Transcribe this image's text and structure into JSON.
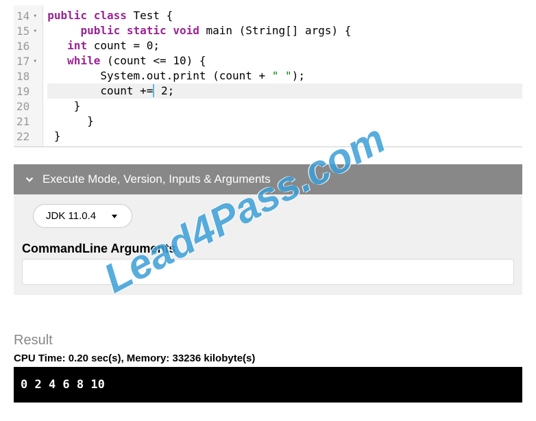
{
  "code": {
    "lines": [
      {
        "num": "14",
        "fold": true
      },
      {
        "num": "15",
        "fold": true
      },
      {
        "num": "16",
        "fold": false
      },
      {
        "num": "17",
        "fold": true
      },
      {
        "num": "18",
        "fold": false
      },
      {
        "num": "19",
        "fold": false,
        "highlight": true
      },
      {
        "num": "20",
        "fold": false
      },
      {
        "num": "21",
        "fold": false
      },
      {
        "num": "22",
        "fold": false
      }
    ],
    "tokens": {
      "l14": {
        "kw_public": "public",
        "kw_class": "class",
        "name": "Test"
      },
      "l15": {
        "kw_public": "public",
        "kw_static": "static",
        "kw_void": "void",
        "fn": "main",
        "params": "(String[] args) {"
      },
      "l16": {
        "type": "int",
        "decl": " count = ",
        "val": "0",
        "semi": ";"
      },
      "l17": {
        "kw_while": "while",
        "cond_open": " (count ",
        "op": "<=",
        "sp": " ",
        "val": "10",
        "cond_close": ") {"
      },
      "l18": {
        "call": "System.out.print (count ",
        "plus": "+",
        "str": " \" \"",
        "close": ");"
      },
      "l19": {
        "var": "count ",
        "op": "+=",
        "sp": " ",
        "val": "2",
        "semi": ";"
      },
      "l20": {
        "br": "}"
      },
      "l21": {
        "br": "}"
      },
      "l22": {
        "br": "}"
      }
    }
  },
  "settings": {
    "header": "Execute Mode, Version, Inputs & Arguments",
    "jdk": "JDK 11.0.4",
    "args_label": "CommandLine Arguments",
    "args_value": ""
  },
  "result": {
    "title": "Result",
    "stats": "CPU Time: 0.20 sec(s), Memory: 33236 kilobyte(s)",
    "output": "0 2 4 6 8 10"
  },
  "watermark": "Lead4Pass.com"
}
